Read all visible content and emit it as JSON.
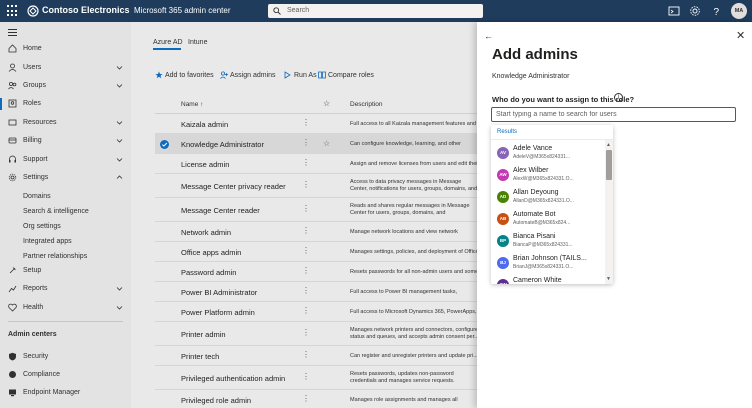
{
  "topbar": {
    "brand": "Contoso Electronics",
    "app_name": "Microsoft 365 admin center",
    "search_placeholder": "Search",
    "avatar_initials": "MA"
  },
  "nav": {
    "items": [
      {
        "label": "Home",
        "icon": "home-icon"
      },
      {
        "label": "Users",
        "icon": "user-icon"
      },
      {
        "label": "Groups",
        "icon": "group-icon"
      },
      {
        "label": "Roles",
        "icon": "roles-icon"
      },
      {
        "label": "Resources",
        "icon": "resources-icon"
      },
      {
        "label": "Billing",
        "icon": "billing-icon"
      },
      {
        "label": "Support",
        "icon": "support-icon"
      },
      {
        "label": "Settings",
        "icon": "gear-icon"
      }
    ],
    "settings_sub": [
      "Domains",
      "Search & intelligence",
      "Org settings",
      "Integrated apps",
      "Partner relationships"
    ],
    "lower_items": [
      {
        "label": "Setup",
        "icon": "setup-icon"
      },
      {
        "label": "Reports",
        "icon": "reports-icon"
      },
      {
        "label": "Health",
        "icon": "health-icon"
      }
    ],
    "admin_centers_heading": "Admin centers",
    "admin_centers": [
      {
        "label": "Security",
        "icon": "shield-icon"
      },
      {
        "label": "Compliance",
        "icon": "compliance-icon"
      },
      {
        "label": "Endpoint Manager",
        "icon": "endpoint-icon"
      }
    ]
  },
  "main": {
    "tabs": [
      "Azure AD",
      "Intune"
    ],
    "commands": [
      "Add to favorites",
      "Assign admins",
      "Run As",
      "Compare roles"
    ],
    "columns": {
      "name": "Name ↑",
      "description": "Description"
    },
    "rows": [
      {
        "name": "Kaizala admin",
        "desc": "Full access to all Kaizala management features and data."
      },
      {
        "name": "Knowledge Administrator",
        "desc": "Can configure knowledge, learning, and other intelligent features.",
        "selected": true
      },
      {
        "name": "License admin",
        "desc": "Assign and remove licenses from users and edit their usage location."
      },
      {
        "name": "Message Center privacy reader",
        "desc": "Access to data privacy messages in Message Center, notifications for users, groups, domains, and subscriptions."
      },
      {
        "name": "Message Center reader",
        "desc": "Reads and shares regular messages in Message Center for users, groups, domains, and subscriptions."
      },
      {
        "name": "Network admin",
        "desc": "Manage network locations and view network performance."
      },
      {
        "name": "Office apps admin",
        "desc": "Manages settings, policies, and deployment of Office apps."
      },
      {
        "name": "Password admin",
        "desc": "Resets passwords for all non-admin users and some admins."
      },
      {
        "name": "Power BI Administrator",
        "desc": "Full access to Power BI management tasks, manage..."
      },
      {
        "name": "Power Platform admin",
        "desc": "Full access to Microsoft Dynamics 365, PowerApps, ..."
      },
      {
        "name": "Printer admin",
        "desc": "Manages network printers and connectors, configure status and queues, and accepts admin consent per..."
      },
      {
        "name": "Printer tech",
        "desc": "Can register and unregister printers and update pri..."
      },
      {
        "name": "Privileged authentication admin",
        "desc": "Resets passwords, updates non-password credentials and manages service requests."
      },
      {
        "name": "Privileged role admin",
        "desc": "Manages role assignments and manages all access..."
      }
    ]
  },
  "panel": {
    "title": "Add admins",
    "subtitle": "Knowledge Administrator",
    "question": "Who do you want to assign to this role?",
    "input_placeholder": "Start typing a name to search for users",
    "results_heading": "Results",
    "people": [
      {
        "name": "Adele Vance",
        "email": "AdeleV@M365x824331...",
        "initials": "AV",
        "color": "#8764b8"
      },
      {
        "name": "Alex Wilber",
        "email": "AlexW@M365x824331.O...",
        "initials": "AW",
        "color": "#c239b3"
      },
      {
        "name": "Allan Deyoung",
        "email": "AllanD@M365x824331.O...",
        "initials": "AD",
        "color": "#498205"
      },
      {
        "name": "Automate Bot",
        "email": "AutomateB@M365x824...",
        "initials": "AB",
        "color": "#ca5010"
      },
      {
        "name": "Bianca Pisani",
        "email": "BiancaP@M365x824331...",
        "initials": "BP",
        "color": "#038387"
      },
      {
        "name": "Brian Johnson (TAILS...",
        "email": "BrianJ@M365x824331.O...",
        "initials": "BJ",
        "color": "#4f6bed"
      },
      {
        "name": "Cameron White",
        "email": "CameronW@M365x824...",
        "initials": "CW",
        "color": "#5c2e91"
      }
    ]
  }
}
